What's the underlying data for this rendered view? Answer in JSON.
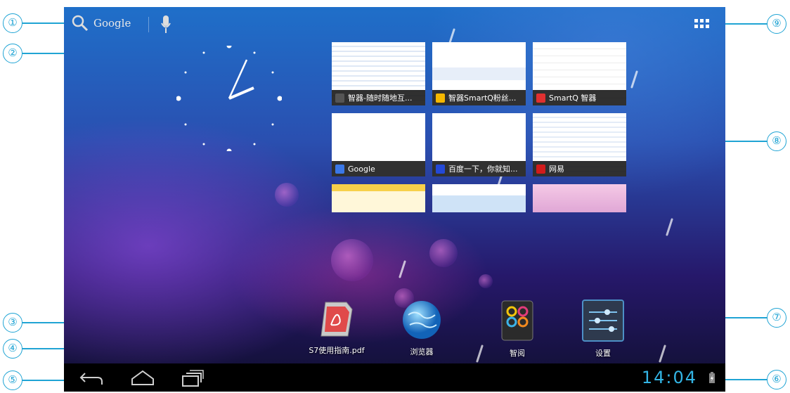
{
  "search": {
    "label": "Google",
    "icon": "search-icon"
  },
  "mic": {
    "icon": "microphone-icon"
  },
  "all_apps": {
    "icon": "all-apps-grid-icon"
  },
  "recent_apps": [
    {
      "title": "智器-随时随地互...",
      "icon_color": "#555555"
    },
    {
      "title": "智器SmartQ粉丝...",
      "icon_color": "#f5b800"
    },
    {
      "title": "SmartQ 智器",
      "icon_color": "#e03030"
    },
    {
      "title": "Google",
      "icon_color": "#3b78e7"
    },
    {
      "title": "百度一下，你就知...",
      "icon_color": "#2449d6"
    },
    {
      "title": "网易",
      "icon_color": "#d21b1b"
    },
    {
      "title": "",
      "icon_color": ""
    },
    {
      "title": "",
      "icon_color": ""
    },
    {
      "title": "",
      "icon_color": ""
    }
  ],
  "shortcuts": [
    {
      "label": "S7使用指南.pdf",
      "icon": "pdf-reader-icon"
    },
    {
      "label": "浏览器",
      "icon": "browser-globe-icon"
    },
    {
      "label": "智阅",
      "icon": "reader-book-icon"
    },
    {
      "label": "设置",
      "icon": "settings-sliders-icon"
    }
  ],
  "status": {
    "time": "14:04",
    "battery_icon": "battery-charging-icon"
  },
  "nav": {
    "back": "back-icon",
    "home": "home-icon",
    "recent": "recent-apps-icon"
  },
  "callouts": [
    "①",
    "②",
    "③",
    "④",
    "⑤",
    "⑥",
    "⑦",
    "⑧",
    "⑨"
  ],
  "colors": {
    "accent": "#33b5e5",
    "callout": "#20a4d4"
  }
}
